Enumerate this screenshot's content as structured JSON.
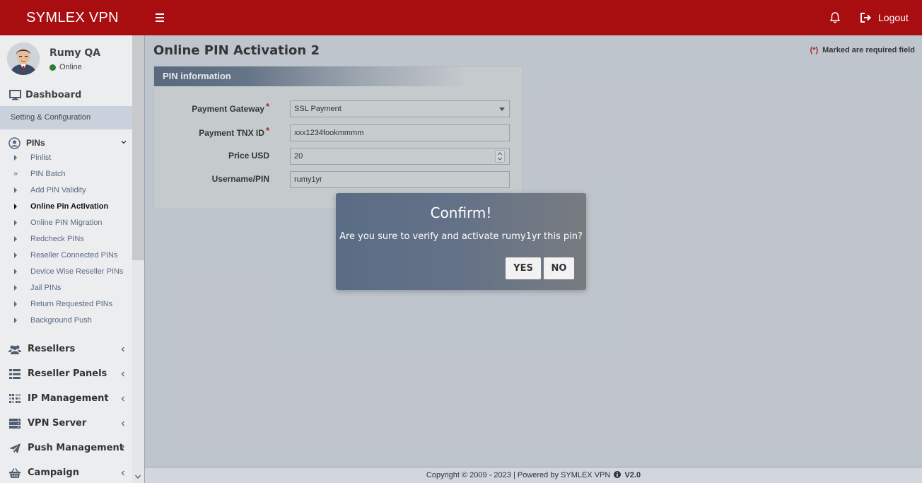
{
  "header": {
    "brand": "SYMLEX VPN",
    "logout_label": "Logout"
  },
  "user": {
    "name": "Rumy QA",
    "status": "Online"
  },
  "sidebar": {
    "dashboard": "Dashboard",
    "setting": "Setting & Configuration",
    "pins": {
      "label": "PINs",
      "items": [
        {
          "label": "Pinlist"
        },
        {
          "label": "PIN Batch"
        },
        {
          "label": "Add PIN Validity"
        },
        {
          "label": "Online Pin Activation"
        },
        {
          "label": "Online PIN Migration"
        },
        {
          "label": "Redcheck PINs"
        },
        {
          "label": "Reseller Connected PINs"
        },
        {
          "label": "Device Wise Reseller PINs"
        },
        {
          "label": "Jail PINs"
        },
        {
          "label": "Return Requested PINs"
        },
        {
          "label": "Background Push"
        }
      ]
    },
    "menus": [
      {
        "label": "Resellers"
      },
      {
        "label": "Reseller Panels"
      },
      {
        "label": "IP Management"
      },
      {
        "label": "VPN Server"
      },
      {
        "label": "Push Management"
      },
      {
        "label": "Campaign"
      }
    ]
  },
  "main": {
    "title": "Online PIN Activation 2",
    "required_asterisk": "(*)",
    "required_note": "Marked are required field",
    "panel_title": "PIN information",
    "fields": {
      "gateway_label": "Payment Gateway",
      "gateway_value": "SSL Payment",
      "tnx_label": "Payment TNX ID",
      "tnx_value": "xxx1234fookmmmm",
      "price_label": "Price USD",
      "price_value": "20",
      "username_label": "Username/PIN",
      "username_value": "rumy1yr",
      "required_mark": "*"
    }
  },
  "modal": {
    "title": "Confirm!",
    "message": "Are you sure to verify and activate rumy1yr this pin?",
    "yes": "YES",
    "no": "NO"
  },
  "footer": {
    "text": "Copyright © 2009 - 2023 | Powered by SYMLEX VPN",
    "version": "V2.0"
  },
  "colors": {
    "header": "#a80d10",
    "online": "#2f7d32",
    "required": "#c0201e"
  }
}
